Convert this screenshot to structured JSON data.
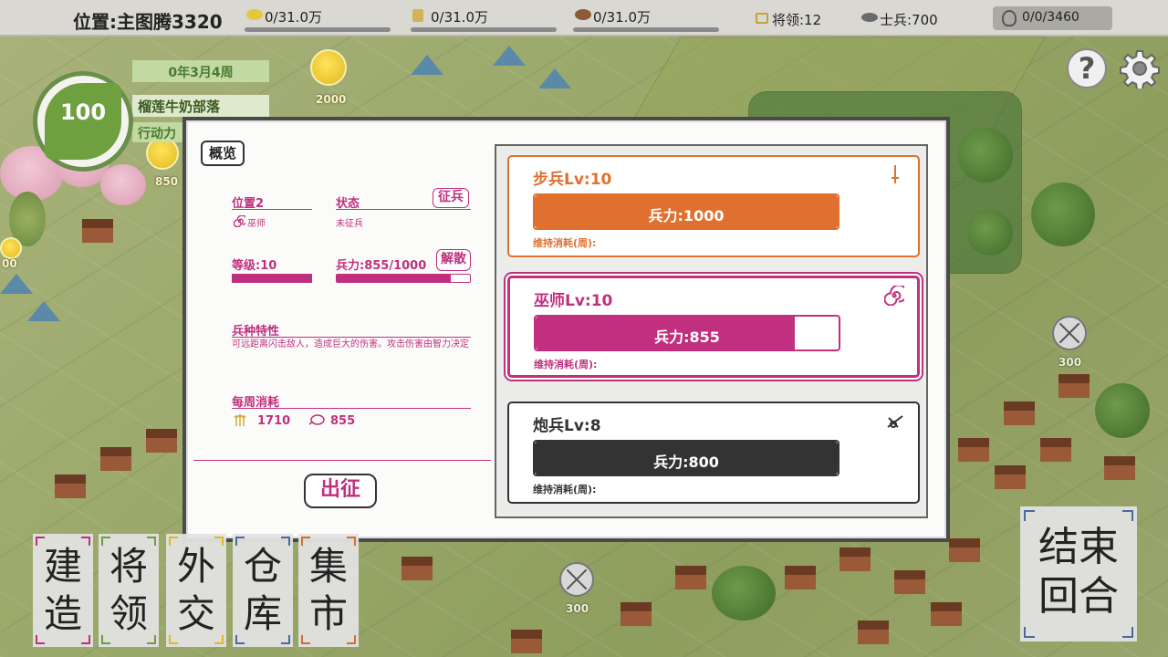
{
  "topbar": {
    "location": "位置:主图腾3320",
    "resources": [
      {
        "name": "gold-icon",
        "value": "0/31.0万",
        "color": "#e6c63a"
      },
      {
        "name": "wheat-icon",
        "value": "0/31.0万",
        "color": "#d2b35a"
      },
      {
        "name": "meat-icon",
        "value": "0/31.0万",
        "color": "#8a5a3a"
      }
    ],
    "generals": "将领:12",
    "soldiers": "士兵:700",
    "population": "0/0/3460"
  },
  "leader": {
    "level": "100",
    "week": "0年3月4周",
    "tribe": "榴莲牛奶部落",
    "action": "行动力"
  },
  "map": {
    "gold_amount": "2000",
    "left_label": "850",
    "left_label2": "00",
    "badge_right_value": "300",
    "badge_bottom_value": "300"
  },
  "dialog": {
    "tab_overview": "概览",
    "position_label": "位置2",
    "unit_name": "巫师",
    "status_label": "状态",
    "status_value": "未征兵",
    "recruit_btn": "征兵",
    "level_label": "等级:10",
    "level_fraction": 1.0,
    "troops_label": "兵力:855/1000",
    "troops_fraction": 0.855,
    "disband_btn": "解散",
    "trait_title": "兵种特性",
    "trait_desc": "可远距离闪击敌人，造成巨大的伤害。攻击伤害由智力决定",
    "weekly_title": "每周消耗",
    "weekly_wheat": "1710",
    "weekly_meat": "855",
    "go_btn": "出征"
  },
  "units": [
    {
      "title": "步兵Lv:10",
      "troops": "兵力:1000",
      "fraction": 1.0,
      "upkeep": "维持消耗(周):",
      "color": "#e07030",
      "icon": "sword-icon"
    },
    {
      "title": "巫师Lv:10",
      "troops": "兵力:855",
      "fraction": 0.855,
      "upkeep": "维持消耗(周):",
      "color": "#c0307f",
      "icon": "spiral-icon"
    },
    {
      "title": "炮兵Lv:8",
      "troops": "兵力:800",
      "fraction": 1.0,
      "upkeep": "维持消耗(周):",
      "color": "#333333",
      "icon": "cannon-icon"
    }
  ],
  "menu": {
    "build": "建造",
    "generals": "将领",
    "diplomacy": "外交",
    "warehouse": "仓库",
    "market": "集市",
    "end_turn": "结束回合"
  },
  "help_label": "?"
}
